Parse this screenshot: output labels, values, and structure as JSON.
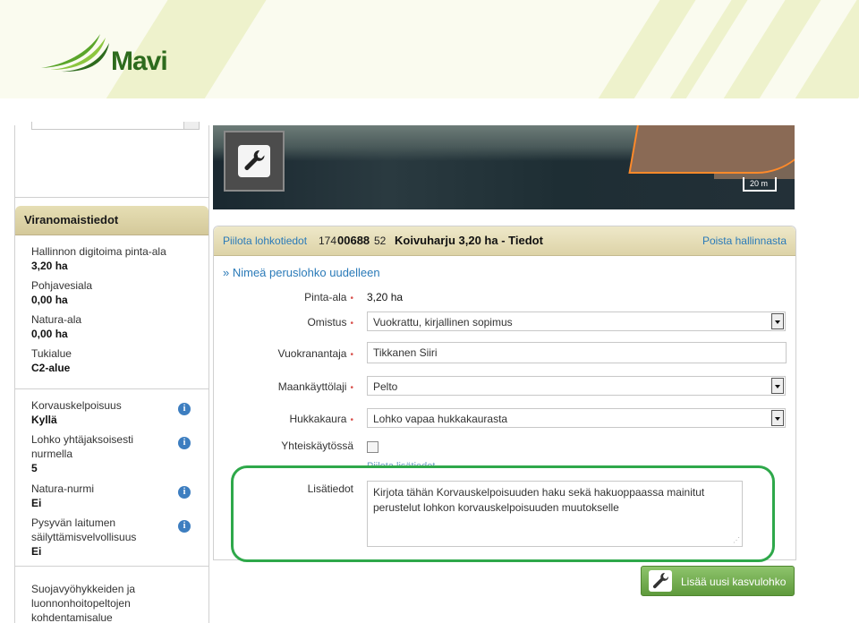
{
  "brand": {
    "logo_text": "Mavi"
  },
  "sidebar": {
    "section_title": "Viranomaistiedot",
    "items": [
      {
        "label": "Hallinnon digitoima pinta-ala",
        "value": "3,20 ha"
      },
      {
        "label": "Pohjavesiala",
        "value": "0,00 ha"
      },
      {
        "label": "Natura-ala",
        "value": "0,00 ha"
      },
      {
        "label": "Tukialue",
        "value": "C2-alue"
      }
    ],
    "info_items": [
      {
        "label": "Korvauskelpoisuus",
        "value": "Kyllä"
      },
      {
        "label": "Lohko yhtäjaksoisesti nurmella",
        "value": "5"
      },
      {
        "label": "Natura-nurmi",
        "value": "Ei"
      },
      {
        "label": "Pysyvän laitumen säilyttämisvelvollisuus",
        "value": "Ei"
      }
    ],
    "bottom_label": "Suojavyöhykkeiden ja luonnonhoitopeltojen kohdentamisalue"
  },
  "map": {
    "scale_label": "20 m"
  },
  "panel": {
    "hide_link": "Piilota lohkotiedot",
    "id_part1": "174",
    "id_part2": "00688",
    "id_part3": "52",
    "title": "Koivuharju 3,20 ha - Tiedot",
    "remove_link": "Poista hallinnasta",
    "rename_link": "» Nimeä peruslohko uudelleen",
    "required_mark": "•",
    "fields": {
      "area_label": "Pinta-ala",
      "area_value": "3,20 ha",
      "ownership_label": "Omistus",
      "ownership_value": "Vuokrattu, kirjallinen sopimus",
      "lessor_label": "Vuokranantaja",
      "lessor_value": "Tikkanen Siiri",
      "landuse_label": "Maankäyttölaji",
      "landuse_value": "Pelto",
      "oat_label": "Hukkakaura",
      "oat_value": "Lohko vapaa hukkakaurasta",
      "shared_label": "Yhteiskäytössä",
      "hide_extra": "Piilota lisätiedot",
      "extra_label": "Lisätiedot",
      "extra_value": "Kirjota tähän Korvauskelpoisuuden haku sekä hakuoppaassa mainitut perustelut lohkon korvauskelpoisuuden muutokselle"
    },
    "add_button": "Lisää uusi kasvulohko"
  },
  "colors": {
    "accent_green": "#2ea84a",
    "link_blue": "#2a7ab8",
    "header_tan": "#ddd3a7"
  }
}
